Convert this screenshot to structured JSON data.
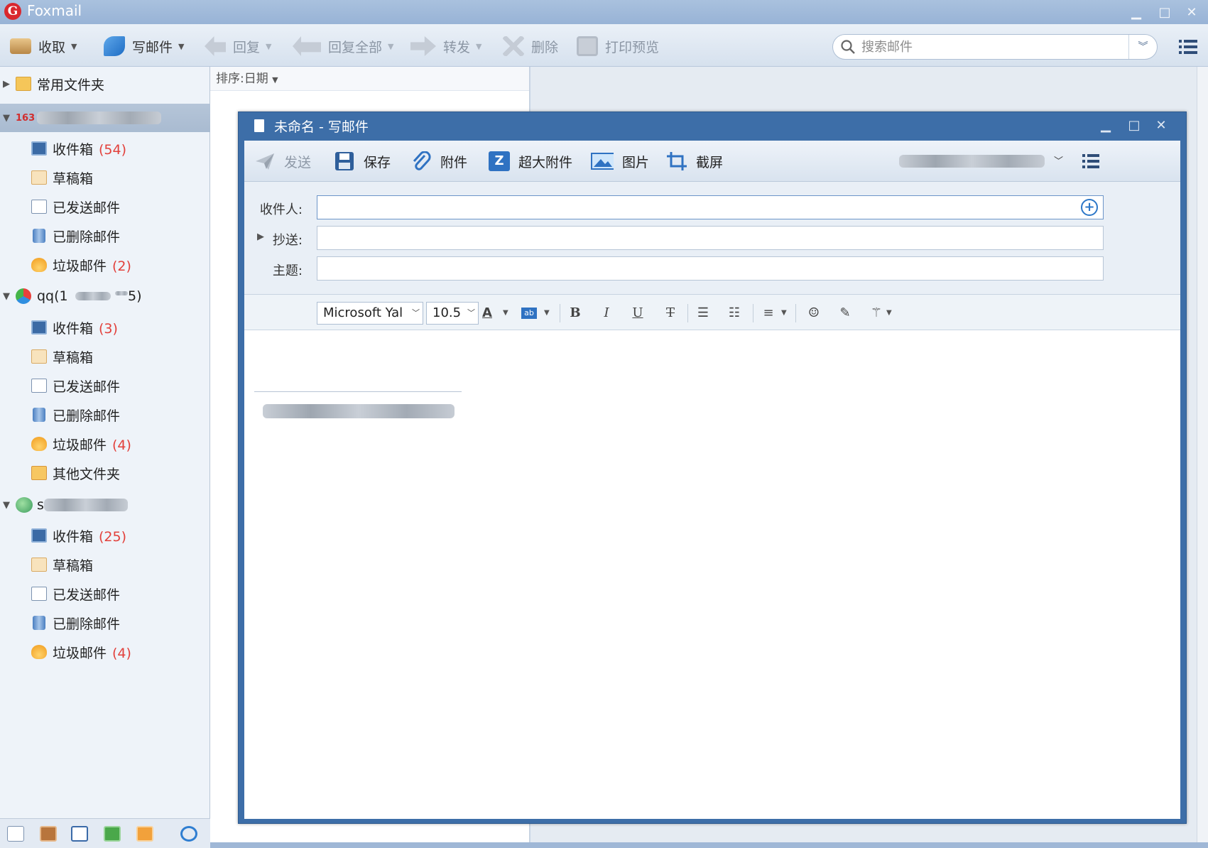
{
  "window": {
    "title": "Foxmail"
  },
  "toolbar": {
    "receive": "收取",
    "compose": "写邮件",
    "reply": "回复",
    "reply_all": "回复全部",
    "forward": "转发",
    "delete": "删除",
    "print_preview": "打印预览"
  },
  "search": {
    "placeholder": "搜索邮件"
  },
  "sidebar": {
    "common_folders": "常用文件夹",
    "account1": {
      "label": "163",
      "folders": [
        {
          "label": "收件箱",
          "count": "(54)"
        },
        {
          "label": "草稿箱",
          "count": ""
        },
        {
          "label": "已发送邮件",
          "count": ""
        },
        {
          "label": "已删除邮件",
          "count": ""
        },
        {
          "label": "垃圾邮件",
          "count": "(2)"
        }
      ]
    },
    "account2": {
      "label_prefix": "qq(1",
      "label_suffix": "5)",
      "folders": [
        {
          "label": "收件箱",
          "count": "(3)"
        },
        {
          "label": "草稿箱",
          "count": ""
        },
        {
          "label": "已发送邮件",
          "count": ""
        },
        {
          "label": "已删除邮件",
          "count": ""
        },
        {
          "label": "垃圾邮件",
          "count": "(4)"
        },
        {
          "label": "其他文件夹",
          "count": ""
        }
      ]
    },
    "account3": {
      "label_prefix": "s",
      "folders": [
        {
          "label": "收件箱",
          "count": "(25)"
        },
        {
          "label": "草稿箱",
          "count": ""
        },
        {
          "label": "已发送邮件",
          "count": ""
        },
        {
          "label": "已删除邮件",
          "count": ""
        },
        {
          "label": "垃圾邮件",
          "count": "(4)"
        }
      ]
    }
  },
  "list": {
    "sort_label": "排序:日期"
  },
  "compose": {
    "title": "未命名 - 写邮件",
    "toolbar": {
      "send": "发送",
      "save": "保存",
      "attach": "附件",
      "large_attach": "超大附件",
      "image": "图片",
      "screenshot": "截屏"
    },
    "fields": {
      "to_label": "收件人:",
      "cc_label": "抄送:",
      "subject_label": "主题:"
    },
    "format": {
      "font": "Microsoft Yal",
      "size": "10.5",
      "bold": "B",
      "italic": "I",
      "underline": "U",
      "strike": "T"
    }
  },
  "colors": {
    "accent": "#3d6ea8",
    "count": "#e2403b"
  }
}
